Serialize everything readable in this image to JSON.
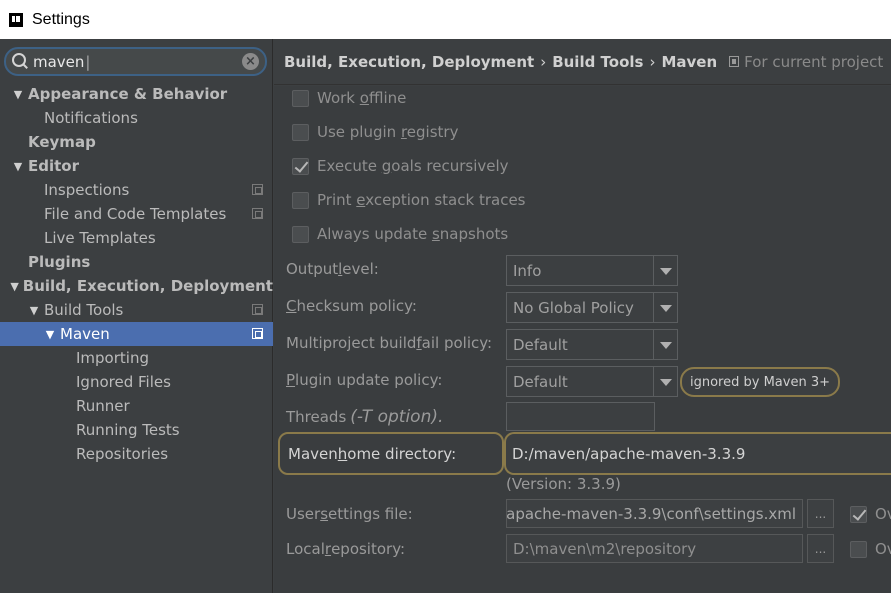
{
  "window": {
    "title": "Settings"
  },
  "search": {
    "value": "maven",
    "clear_icon": "clear-icon"
  },
  "tree": [
    {
      "label": "Appearance & Behavior",
      "level": 0,
      "arrow": "▼",
      "bold": true
    },
    {
      "label": "Notifications",
      "level": 1
    },
    {
      "label": "Keymap",
      "level": 0,
      "bold": true
    },
    {
      "label": "Editor",
      "level": 0,
      "arrow": "▼",
      "bold": true
    },
    {
      "label": "Inspections",
      "level": 1,
      "copy": true
    },
    {
      "label": "File and Code Templates",
      "level": 1,
      "copy": true
    },
    {
      "label": "Live Templates",
      "level": 1
    },
    {
      "label": "Plugins",
      "level": 0,
      "bold": true
    },
    {
      "label": "Build, Execution, Deployment",
      "level": 0,
      "arrow": "▼",
      "bold": true
    },
    {
      "label": "Build Tools",
      "level": 1,
      "arrow": "▼",
      "copy": true
    },
    {
      "label": "Maven",
      "level": 2,
      "arrow": "▼",
      "copy": true,
      "selected": true
    },
    {
      "label": "Importing",
      "level": 3
    },
    {
      "label": "Ignored Files",
      "level": 3
    },
    {
      "label": "Runner",
      "level": 3
    },
    {
      "label": "Running Tests",
      "level": 3
    },
    {
      "label": "Repositories",
      "level": 3
    }
  ],
  "breadcrumb": {
    "items": [
      "Build, Execution, Deployment",
      "Build Tools",
      "Maven"
    ],
    "separator": "›",
    "scope": "For current project"
  },
  "options": {
    "work_offline": {
      "pre": "Work ",
      "u": "o",
      "post": "ffline",
      "checked": false
    },
    "plugin_registry": {
      "pre": "Use plugin ",
      "u": "r",
      "post": "egistry",
      "checked": false
    },
    "execute_goals": {
      "pre": "Execute ",
      "u": "g",
      "post": "oals recursively",
      "checked": true
    },
    "print_exception": {
      "pre": "Print ",
      "u": "e",
      "post": "xception stack traces",
      "checked": false
    },
    "always_update": {
      "pre": "Always update ",
      "u": "s",
      "post": "napshots",
      "checked": false
    }
  },
  "fields": {
    "output_level": {
      "pre": "Output ",
      "u": "l",
      "post": "evel:",
      "value": "Info"
    },
    "checksum_policy": {
      "pre": "",
      "u": "C",
      "post": "hecksum policy:",
      "value": "No Global Policy"
    },
    "multiproject_fail": {
      "pre": "Multiproject build ",
      "u": "f",
      "post": "ail policy:",
      "value": "Default"
    },
    "plugin_update": {
      "pre": "",
      "u": "P",
      "post": "lugin update policy:",
      "value": "Default",
      "badge": "ignored by Maven 3+"
    },
    "threads": {
      "pre": "Threads ",
      "hint": "(-T option)."
    },
    "maven_home": {
      "pre": "Maven ",
      "u": "h",
      "post": "ome directory:",
      "value": "D:/maven/apache-maven-3.3.9",
      "version": "(Version: 3.3.9)"
    },
    "user_settings": {
      "pre": "User ",
      "u": "s",
      "post": "ettings file:",
      "value": "apache-maven-3.3.9\\conf\\settings.xml",
      "override_checked": true,
      "override_label": "Ov"
    },
    "local_repo": {
      "pre": "Local ",
      "u": "r",
      "post": "epository:",
      "value": "D:\\maven\\m2\\repository",
      "override_checked": false,
      "override_label": "Ov"
    }
  },
  "browse_label": "..."
}
